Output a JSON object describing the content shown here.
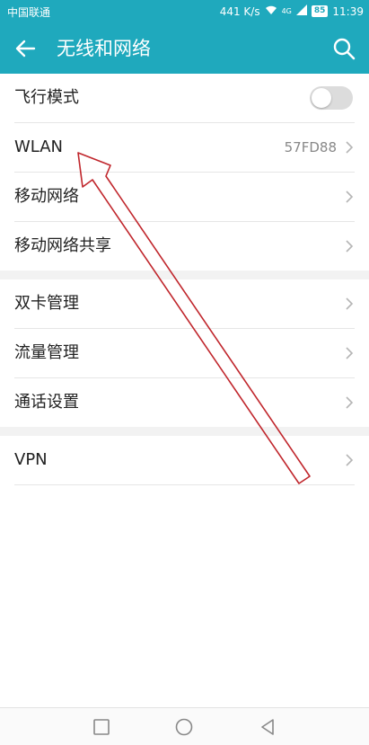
{
  "status_bar": {
    "carrier": "中国联通",
    "speed": "441 K/s",
    "network": "4G",
    "battery": "85",
    "time": "11:39"
  },
  "header": {
    "title": "无线和网络",
    "back_icon": "arrow-left-icon",
    "search_icon": "search-icon"
  },
  "sections": [
    {
      "items": [
        {
          "label": "飞行模式",
          "control": "toggle",
          "toggle_on": false
        },
        {
          "label": "WLAN",
          "value": "57FD88",
          "control": "chevron"
        },
        {
          "label": "移动网络",
          "control": "chevron"
        },
        {
          "label": "移动网络共享",
          "control": "chevron"
        }
      ]
    },
    {
      "items": [
        {
          "label": "双卡管理",
          "control": "chevron"
        },
        {
          "label": "流量管理",
          "control": "chevron"
        },
        {
          "label": "通话设置",
          "control": "chevron"
        }
      ]
    },
    {
      "items": [
        {
          "label": "VPN",
          "control": "chevron"
        }
      ]
    }
  ],
  "nav_bar": {
    "recents_icon": "square-icon",
    "home_icon": "circle-icon",
    "back_icon": "triangle-back-icon"
  },
  "colors": {
    "primary": "#1fa9bd",
    "annotation": "#c0262c",
    "divider_band": "#f2f2f2"
  }
}
